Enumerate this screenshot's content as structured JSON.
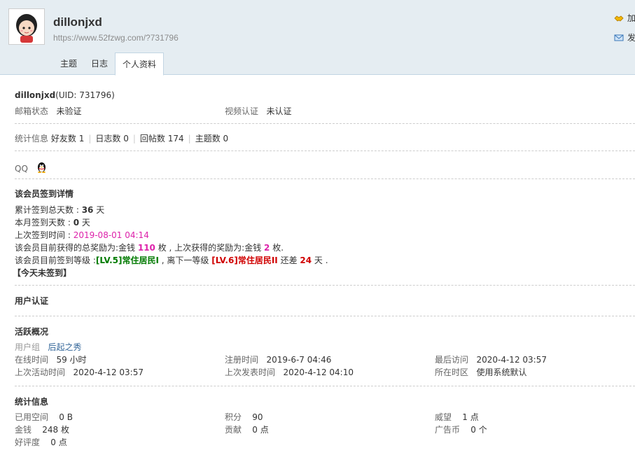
{
  "header": {
    "username": "dillonjxd",
    "url": "https://www.52fzwg.com/?731796",
    "actions": [
      {
        "label": "加",
        "icon": "handshake-icon"
      },
      {
        "label": "发",
        "icon": "mail-icon"
      }
    ],
    "tabs": [
      {
        "label": "主题"
      },
      {
        "label": "日志"
      },
      {
        "label": "个人资料"
      }
    ]
  },
  "profile": {
    "name": "dillonjxd",
    "uid_text": "(UID: 731796)",
    "email_label": "邮箱状态",
    "email_value": "未验证",
    "video_label": "视频认证",
    "video_value": "未认证",
    "stats_label": "统计信息",
    "stats": [
      {
        "label": "好友数",
        "value": "1"
      },
      {
        "label": "日志数",
        "value": "0"
      },
      {
        "label": "回帖数",
        "value": "174"
      },
      {
        "label": "主题数",
        "value": "0"
      }
    ],
    "qq_label": "QQ"
  },
  "signin": {
    "title": "该会员签到详情",
    "total_label": "累计签到总天数 : ",
    "total_value": "36",
    "total_unit": " 天",
    "month_label": "本月签到天数 : ",
    "month_value": "0",
    "month_unit": " 天",
    "last_label": "上次签到时间 : ",
    "last_value": "2019-08-01 04:14",
    "reward_prefix": "该会员目前获得的总奖励为:金钱 ",
    "reward_total": "110",
    "reward_mid": " 枚 , 上次获得的奖励为:金钱 ",
    "reward_last": "2",
    "reward_suffix": " 枚.",
    "level_prefix": "该会员目前签到等级 :",
    "level_current": "[LV.5]常住居民I",
    "level_mid": " , 离下一等级 ",
    "level_next": "[LV.6]常住居民II",
    "level_gap_prefix": " 还差 ",
    "level_gap": "24",
    "level_gap_suffix": " 天 .",
    "today": "【今天未签到】"
  },
  "auth": {
    "title": "用户认证"
  },
  "activity": {
    "title": "活跃概况",
    "group_label": "用户组",
    "group_value": "后起之秀",
    "online_label": "在线时间",
    "online_value": "59 小时",
    "reg_label": "注册时间",
    "reg_value": "2019-6-7 04:46",
    "lastvisit_label": "最后访问",
    "lastvisit_value": "2020-4-12 03:57",
    "lastactive_label": "上次活动时间",
    "lastactive_value": "2020-4-12 03:57",
    "lastpost_label": "上次发表时间",
    "lastpost_value": "2020-4-12 04:10",
    "tz_label": "所在时区",
    "tz_value": "使用系统默认"
  },
  "statistics": {
    "title": "统计信息",
    "space_label": "已用空间",
    "space_value": "0 B",
    "credits_label": "积分",
    "credits_value": "90",
    "prestige_label": "威望",
    "prestige_value": "1 点",
    "money_label": "金钱",
    "money_value": "248 枚",
    "contrib_label": "贡献",
    "contrib_value": "0 点",
    "adcoin_label": "广告币",
    "adcoin_value": "0 个",
    "rating_label": "好评度",
    "rating_value": "0 点"
  },
  "colors": {
    "header_bg": "#e5edf2",
    "border": "#c2d5e3",
    "link": "#336699",
    "pink": "#dd22aa",
    "green": "#007a00",
    "red": "#d00000"
  }
}
